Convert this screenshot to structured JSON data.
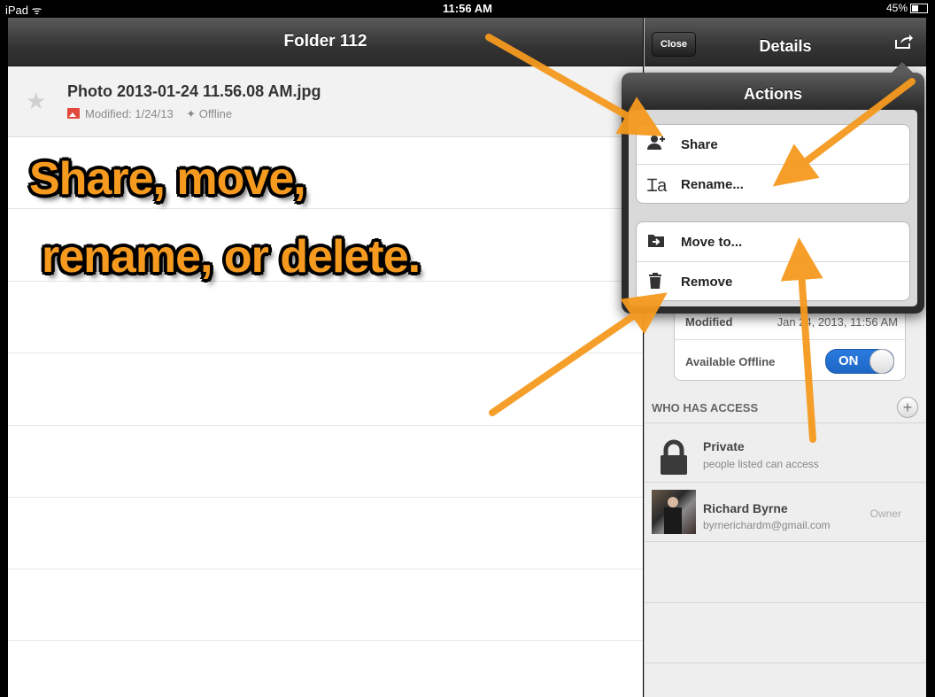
{
  "status": {
    "device": "iPad",
    "time": "11:56 AM",
    "battery": "45%",
    "battery_level": 0.45
  },
  "left": {
    "title": "Folder 112",
    "file": {
      "name": "Photo 2013-01-24 11.56.08 AM.jpg",
      "modified": "Modified: 1/24/13",
      "offline": "Offline"
    }
  },
  "overlay": {
    "line1": "Share, move,",
    "line2": "rename, or delete."
  },
  "right": {
    "close_label": "Close",
    "title": "Details",
    "details": {
      "modified_label": "Modified",
      "modified_value": "Jan 24, 2013, 11:56 AM",
      "offline_label": "Available Offline",
      "toggle_label": "ON"
    },
    "access_header": "WHO HAS ACCESS",
    "private_title": "Private",
    "private_sub": "people listed can access",
    "person": {
      "name": "Richard Byrne",
      "email": "byrnerichardm@gmail.com",
      "role": "Owner"
    }
  },
  "popover": {
    "title": "Actions",
    "items": [
      {
        "label": "Share",
        "icon": "add-person-icon"
      },
      {
        "label": "Rename...",
        "icon": "text-cursor-icon"
      },
      {
        "label": "Move to...",
        "icon": "move-folder-icon"
      },
      {
        "label": "Remove",
        "icon": "trash-icon"
      }
    ]
  },
  "colors": {
    "accent_orange": "#f59a1f",
    "toggle_blue": "#1e66c5",
    "nav_dark": "#343434"
  }
}
